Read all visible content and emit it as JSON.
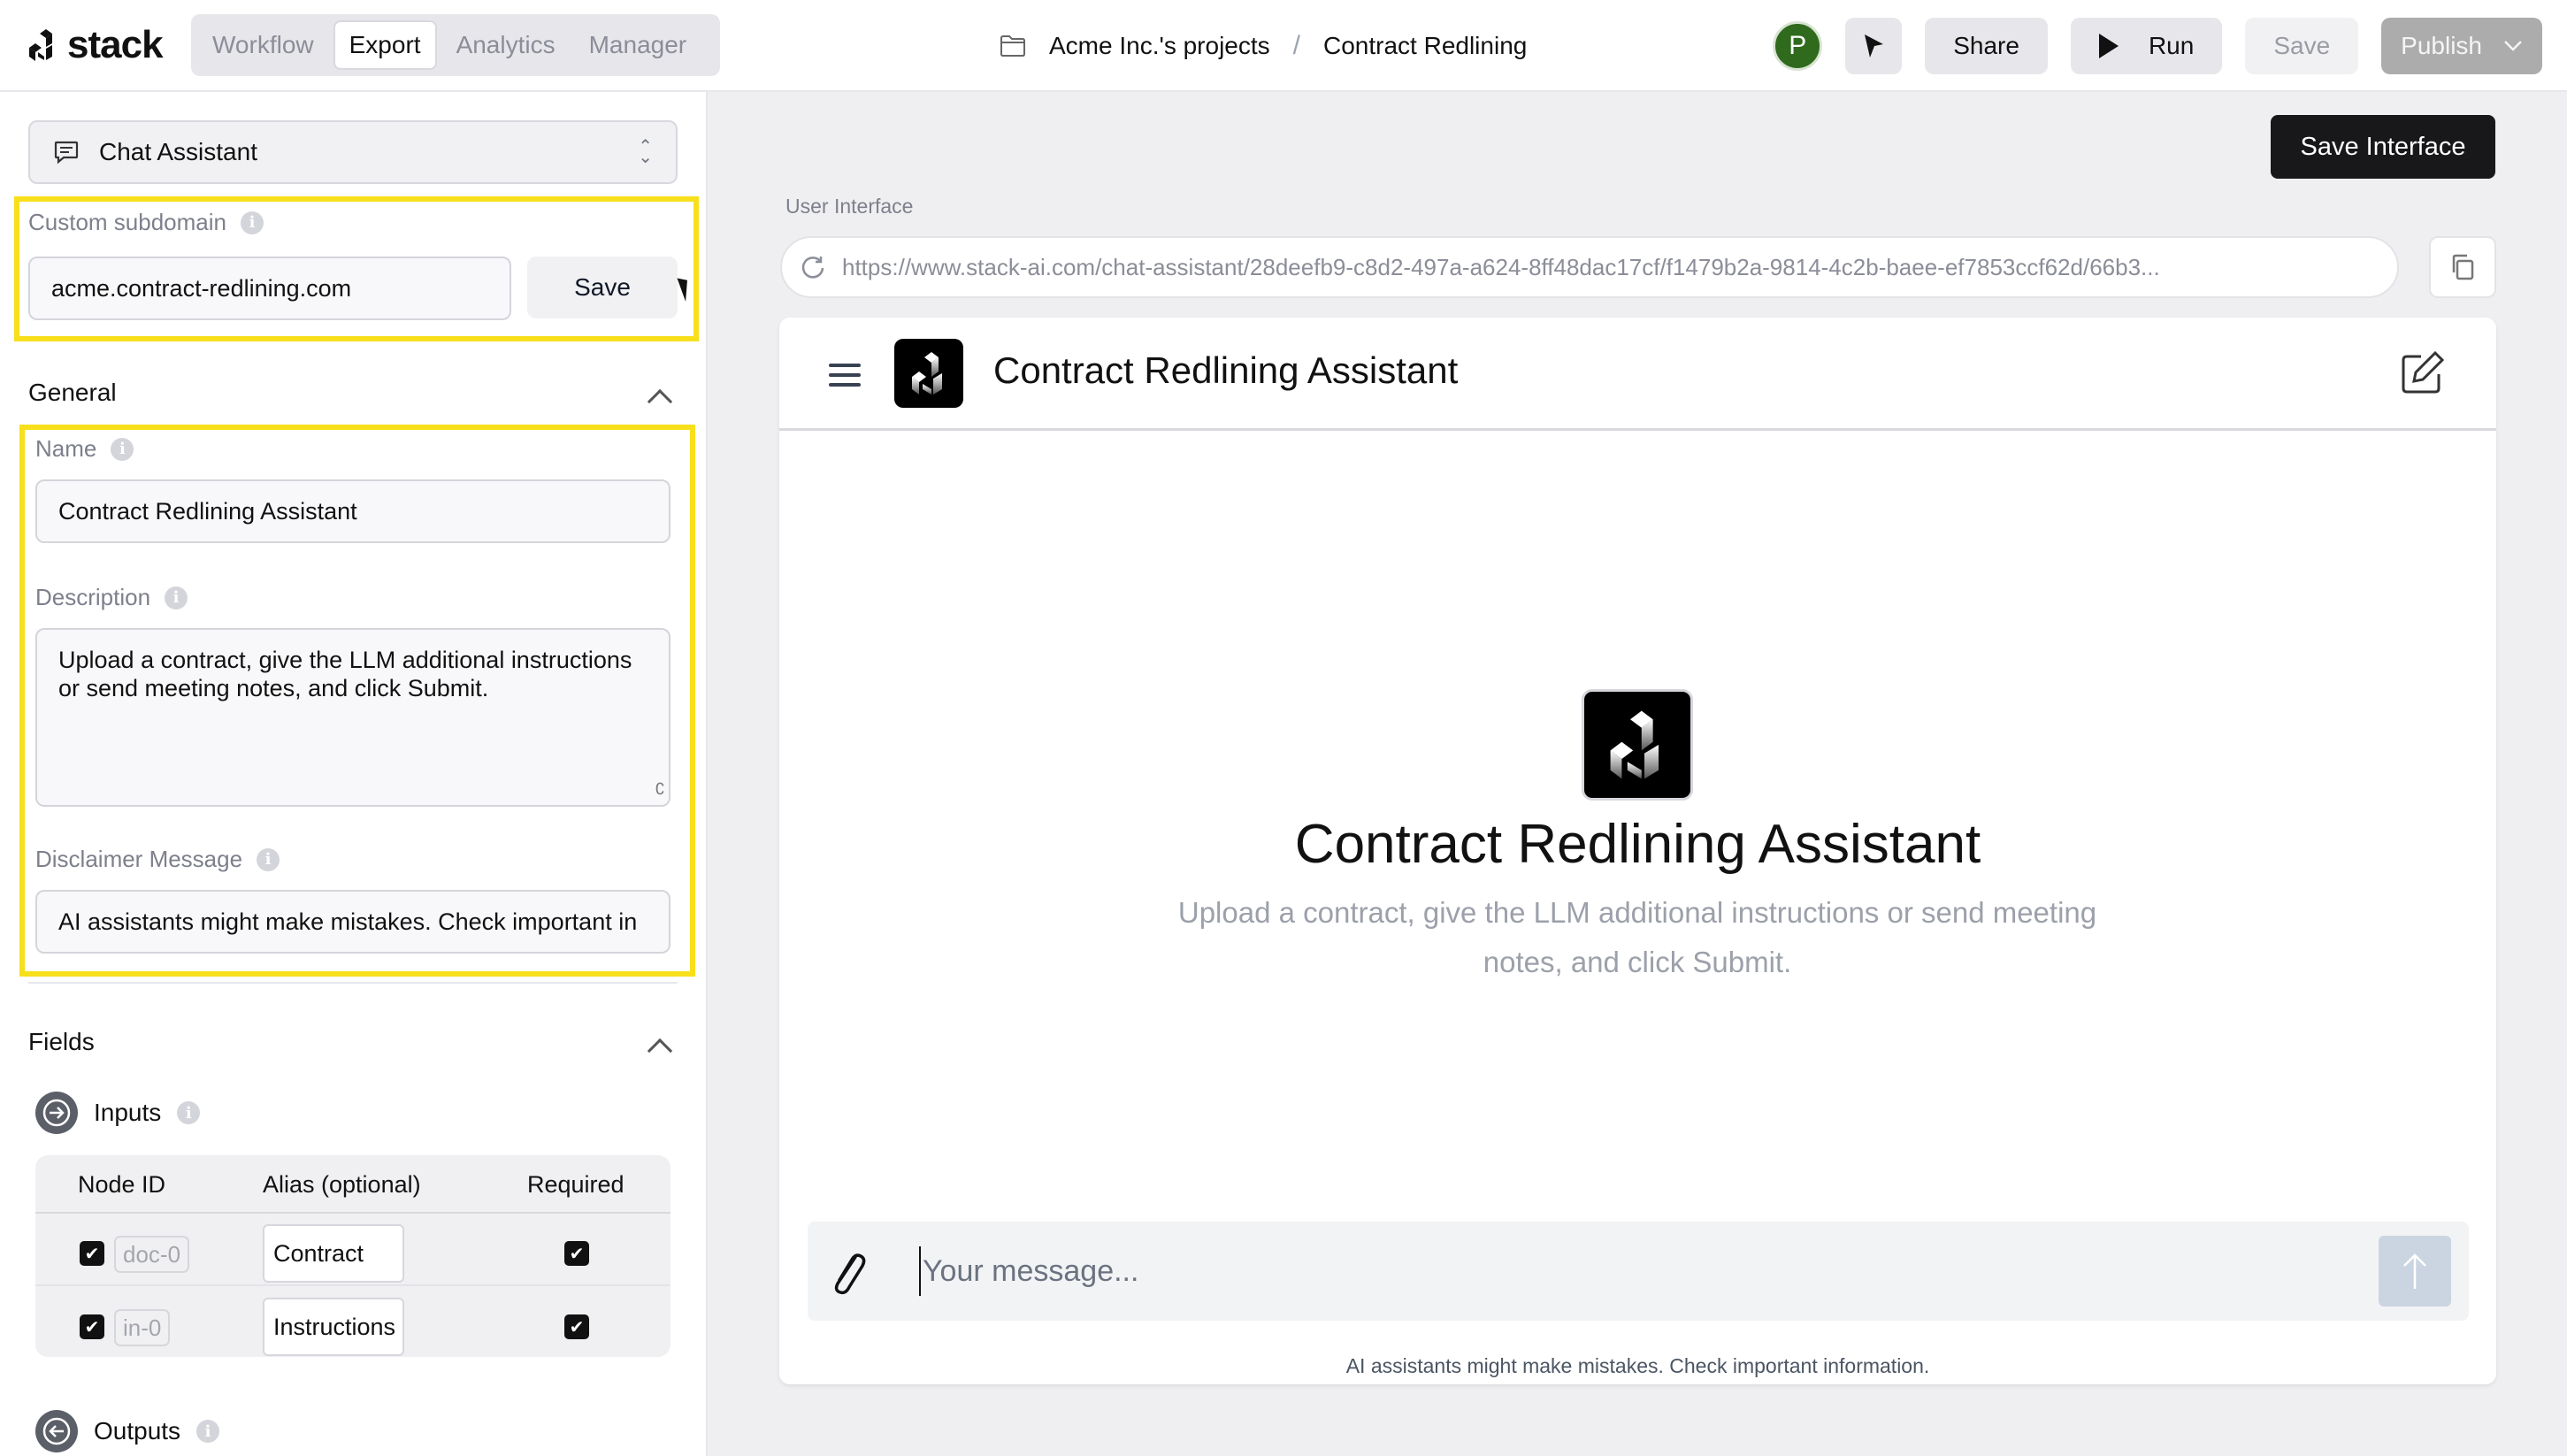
{
  "header": {
    "logo_text": "stack",
    "tabs": [
      {
        "label": "Workflow",
        "active": false
      },
      {
        "label": "Export",
        "active": true
      },
      {
        "label": "Analytics",
        "active": false
      },
      {
        "label": "Manager",
        "active": false
      }
    ],
    "breadcrumb": {
      "folder": "Acme Inc.'s projects",
      "separator": "/",
      "project": "Contract Redlining"
    },
    "avatar_initial": "P",
    "buttons": {
      "share": "Share",
      "run": "Run",
      "save": "Save",
      "publish": "Publish"
    }
  },
  "left_panel": {
    "interface_select": "Chat Assistant",
    "custom_subdomain": {
      "label": "Custom subdomain",
      "value": "acme.contract-redlining.com",
      "save_label": "Save"
    },
    "general": {
      "title": "General",
      "name_label": "Name",
      "name_value": "Contract Redlining Assistant",
      "description_label": "Description",
      "description_value": "Upload a contract, give the LLM additional instructions or send meeting notes, and click Submit.",
      "disclaimer_label": "Disclaimer Message",
      "disclaimer_value": "AI assistants might make mistakes. Check important in"
    },
    "fields": {
      "title": "Fields",
      "inputs_label": "Inputs",
      "outputs_label": "Outputs",
      "columns": [
        "Node ID",
        "Alias (optional)",
        "Required"
      ],
      "rows": [
        {
          "enabled": true,
          "node_id": "doc-0",
          "alias": "Contract",
          "required": true
        },
        {
          "enabled": true,
          "node_id": "in-0",
          "alias": "Instructions",
          "required": true
        }
      ]
    }
  },
  "right_panel": {
    "save_interface_label": "Save Interface",
    "ui_label": "User Interface",
    "url": "https://www.stack-ai.com/chat-assistant/28deefb9-c8d2-497a-a624-8ff48dac17cf/f1479b2a-9814-4c2b-baee-ef7853ccf62d/66b3...",
    "chat": {
      "title": "Contract Redlining Assistant",
      "welcome_title": "Contract Redlining Assistant",
      "welcome_description": "Upload a contract, give the LLM additional instructions or send meeting notes, and click Submit.",
      "message_placeholder": "Your message...",
      "disclaimer": "AI assistants might make mistakes. Check important information."
    }
  },
  "colors": {
    "highlight": "#f8df1c",
    "avatar": "#2f6a1d",
    "primary_dark": "#18181b",
    "send_disabled": "#cbd5e1"
  }
}
